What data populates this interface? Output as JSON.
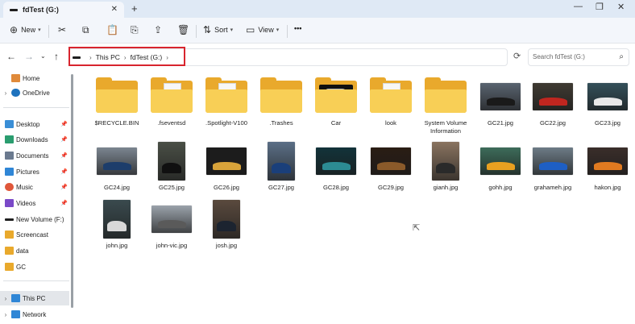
{
  "window": {
    "tab_title": "fdTest (G:)",
    "tab_close": "✕",
    "new_tab": "+",
    "controls": {
      "minimize": "—",
      "maximize": "❐",
      "close": "✕"
    }
  },
  "toolbar": {
    "new_label": "New",
    "sort_label": "Sort",
    "view_label": "View",
    "more_label": "•••"
  },
  "address": {
    "crumbs": [
      "This PC",
      "fdTest (G:)"
    ],
    "search_placeholder": "Search fdTest (G:)"
  },
  "sidebar": {
    "items": [
      {
        "label": "Home",
        "icon": "home-icon",
        "color": "#e08a3a"
      },
      {
        "label": "OneDrive",
        "icon": "cloud-icon",
        "color": "#1e73be"
      },
      {
        "label": "Desktop",
        "icon": "desktop-icon",
        "color": "#3a8ed6"
      },
      {
        "label": "Downloads",
        "icon": "download-icon",
        "color": "#2a9d6f"
      },
      {
        "label": "Documents",
        "icon": "document-icon",
        "color": "#6b7a8f"
      },
      {
        "label": "Pictures",
        "icon": "picture-icon",
        "color": "#2f86d6"
      },
      {
        "label": "Music",
        "icon": "music-icon",
        "color": "#e0573a"
      },
      {
        "label": "Videos",
        "icon": "video-icon",
        "color": "#7a49c8"
      },
      {
        "label": "New Volume (F:)",
        "icon": "drive-icon",
        "color": "#1f1f1f"
      },
      {
        "label": "Screencast",
        "icon": "folder-icon",
        "color": "#e9a92c"
      },
      {
        "label": "data",
        "icon": "folder-icon",
        "color": "#e9a92c"
      },
      {
        "label": "GC",
        "icon": "folder-icon",
        "color": "#e9a92c"
      },
      {
        "label": "This PC",
        "icon": "computer-icon",
        "color": "#2f86d6"
      },
      {
        "label": "Network",
        "icon": "network-icon",
        "color": "#2f86d6"
      }
    ]
  },
  "files": [
    {
      "name": "$RECYCLE.BIN",
      "kind": "folder"
    },
    {
      "name": ".fseventsd",
      "kind": "folder-doc"
    },
    {
      "name": ".Spotlight-V100",
      "kind": "folder-doc"
    },
    {
      "name": ".Trashes",
      "kind": "folder"
    },
    {
      "name": "Car",
      "kind": "folder-img"
    },
    {
      "name": "look",
      "kind": "folder-doc"
    },
    {
      "name": "System Volume Information",
      "kind": "folder"
    },
    {
      "name": "GC21.jpg",
      "kind": "image",
      "bg": "#5a6470",
      "car": "#1a1a1a"
    },
    {
      "name": "GC22.jpg",
      "kind": "image",
      "bg": "#3f3a32",
      "car": "#c0261f"
    },
    {
      "name": "GC23.jpg",
      "kind": "image",
      "bg": "#34505a",
      "car": "#e8e8e8"
    },
    {
      "name": "GC24.jpg",
      "kind": "image",
      "bg": "#7b8590",
      "car": "#1d3d6b"
    },
    {
      "name": "GC25.jpg",
      "kind": "image",
      "bg": "#4a4f46",
      "car": "#101010"
    },
    {
      "name": "GC26.jpg",
      "kind": "image",
      "bg": "#1c1c1c",
      "car": "#d8a33a"
    },
    {
      "name": "GC27.jpg",
      "kind": "image",
      "bg": "#5b6f86",
      "car": "#1a3f7a"
    },
    {
      "name": "GC28.jpg",
      "kind": "image",
      "bg": "#12333a",
      "car": "#2c8b93"
    },
    {
      "name": "GC29.jpg",
      "kind": "image",
      "bg": "#2a1d14",
      "car": "#8a5a2a"
    },
    {
      "name": "gianh.jpg",
      "kind": "image",
      "bg": "#8a7460",
      "car": "#2a2a2a"
    },
    {
      "name": "gohh.jpg",
      "kind": "image",
      "bg": "#3d6c5a",
      "car": "#e8a020"
    },
    {
      "name": "grahameh.jpg",
      "kind": "image",
      "bg": "#6d7b86",
      "car": "#1e5fc4"
    },
    {
      "name": "hakon.jpg",
      "kind": "image",
      "bg": "#3a2e2a",
      "car": "#e07a20"
    },
    {
      "name": "john.jpg",
      "kind": "image",
      "bg": "#3a4a4e",
      "car": "#d8d8d8"
    },
    {
      "name": "john-vic.jpg",
      "kind": "image",
      "bg": "#9aa2aa",
      "car": "#5a5a5a"
    },
    {
      "name": "josh.jpg",
      "kind": "image",
      "bg": "#5a4a3e",
      "car": "#1c2430"
    }
  ]
}
